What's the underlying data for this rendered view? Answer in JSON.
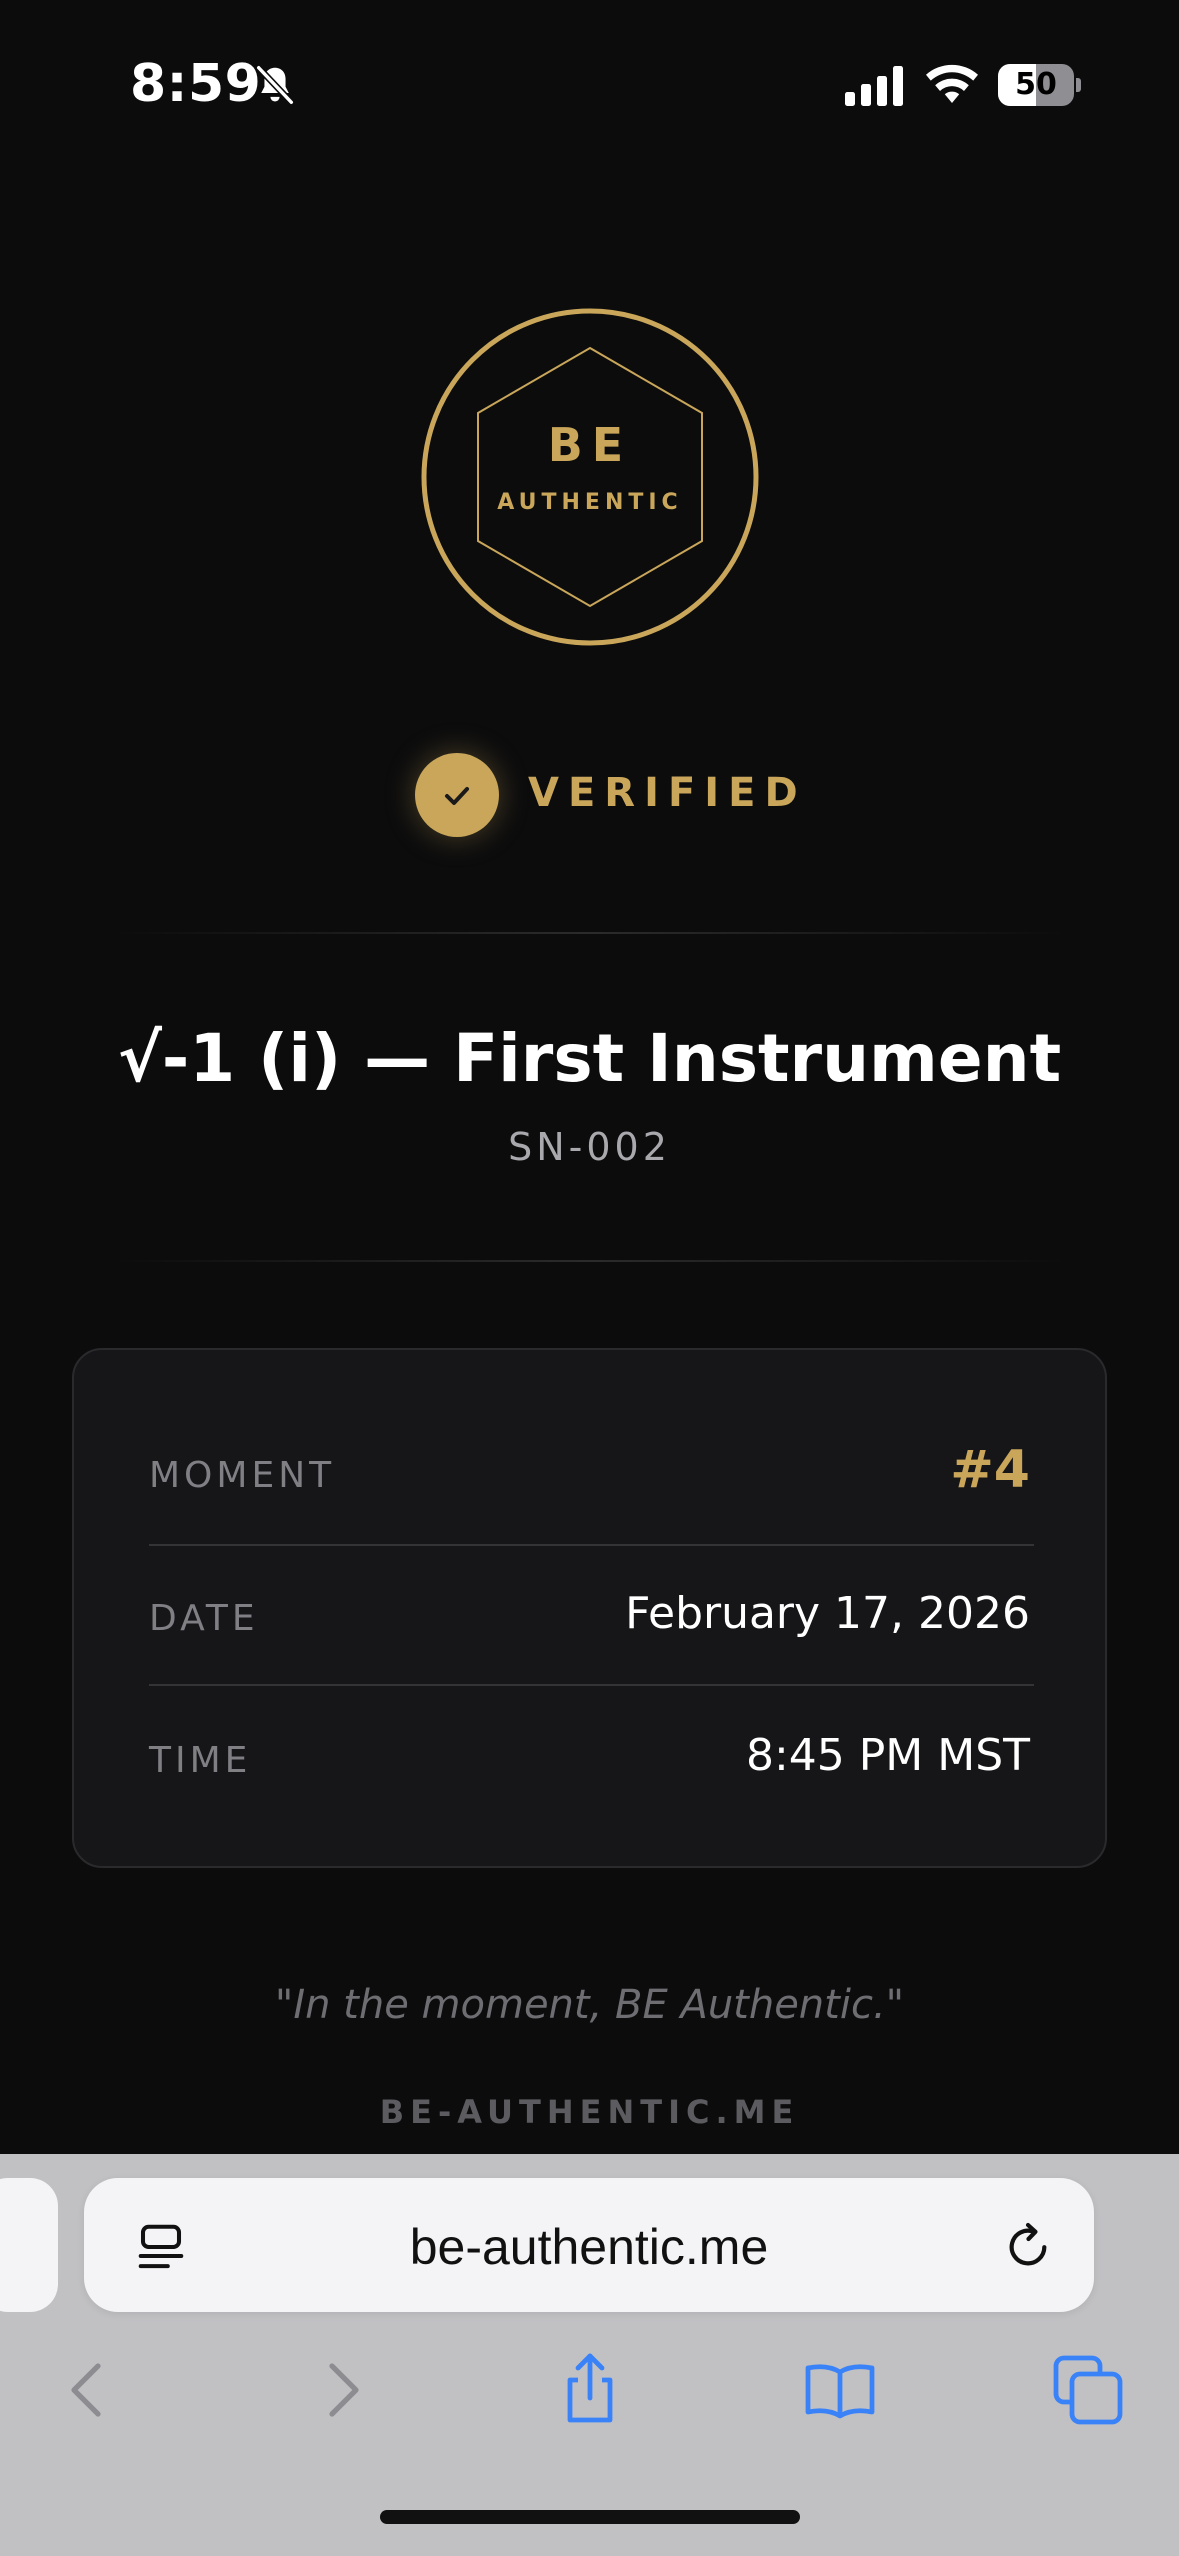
{
  "status_bar": {
    "time": "8:59",
    "battery_percent": 50,
    "battery_label": "50",
    "icons": [
      "bell-slash-icon",
      "cellular-signal-icon",
      "wifi-icon",
      "battery-icon"
    ]
  },
  "logo": {
    "line1": "BE",
    "line2": "AUTHENTIC",
    "color": "#c9a65a"
  },
  "verification": {
    "label": "VERIFIED",
    "icon": "checkmark-icon"
  },
  "item": {
    "title": "√-1 (i) — First Instrument",
    "serial": "SN-002"
  },
  "details": [
    {
      "label": "MOMENT",
      "value": "#4"
    },
    {
      "label": "DATE",
      "value": "February 17, 2026"
    },
    {
      "label": "TIME",
      "value": "8:45 PM MST"
    }
  ],
  "quote": "\"In the moment, BE Authentic.\"",
  "footer": "BE-AUTHENTIC.ME",
  "browser": {
    "address": "be-authentic.me",
    "toolbar_icons": [
      "back-icon",
      "forward-icon",
      "share-icon",
      "bookmarks-icon",
      "tabs-icon"
    ]
  },
  "colors": {
    "background": "#0c0c0d",
    "accent_gold": "#c9a65a",
    "card": "#161618",
    "safari_blue": "#3a82f7"
  }
}
